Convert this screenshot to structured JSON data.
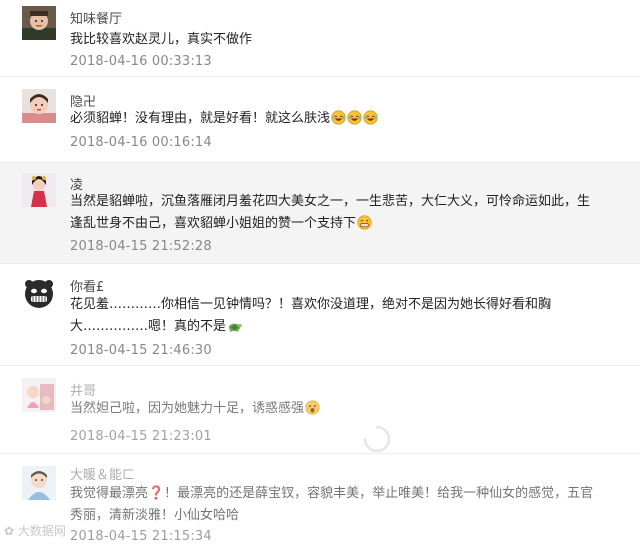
{
  "comments": [
    {
      "author": "知味餐厅",
      "text": "我比较喜欢赵灵儿，真实不做作",
      "time": "2018-04-16 00:33:13",
      "emojis": []
    },
    {
      "author": "隐卍",
      "text": "必须貂蝉！没有理由，就是好看！就这么肤浅",
      "time": "2018-04-16 00:16:14",
      "emojis": [
        "laughing-tears-icon",
        "laughing-tears-icon",
        "laughing-tears-icon"
      ]
    },
    {
      "author": "凌",
      "text": "当然是貂蝉啦，沉鱼落雁闭月羞花四大美女之一，一生悲苦，大仁大义，可怜命运如此，生逢乱世身不由己，喜欢貂蝉小姐姐的赞一个支持下",
      "time": "2018-04-15 21:52:28",
      "emojis": [
        "grin-icon"
      ]
    },
    {
      "author": "你看£",
      "text": "花见羞…………你相信一见钟情吗？！喜欢你没道理，绝对不是因为她长得好看和胸大……………嗯！真的不是",
      "time": "2018-04-15 21:46:30",
      "emojis": [
        "turtle-icon"
      ]
    },
    {
      "author": "井哥",
      "text": "当然妲己啦，因为她魅力十足，诱惑感强",
      "time": "2018-04-15 21:23:01",
      "emojis": [
        "surprised-face-icon"
      ]
    },
    {
      "author": "大暖＆能ㄈ",
      "text": "我觉得最漂亮❓！最漂亮的还是薛宝钗，容貌丰美，举止唯美！给我一种仙女的感觉，五官秀丽，清新淡雅！小仙女哈哈",
      "time": "2018-04-15 21:15:34",
      "emojis": []
    }
  ],
  "watermark": "大数据网",
  "colors": {
    "alt_row_bg": "#f4f4f4",
    "time_text": "#888888",
    "divider": "#e9e9e9"
  }
}
